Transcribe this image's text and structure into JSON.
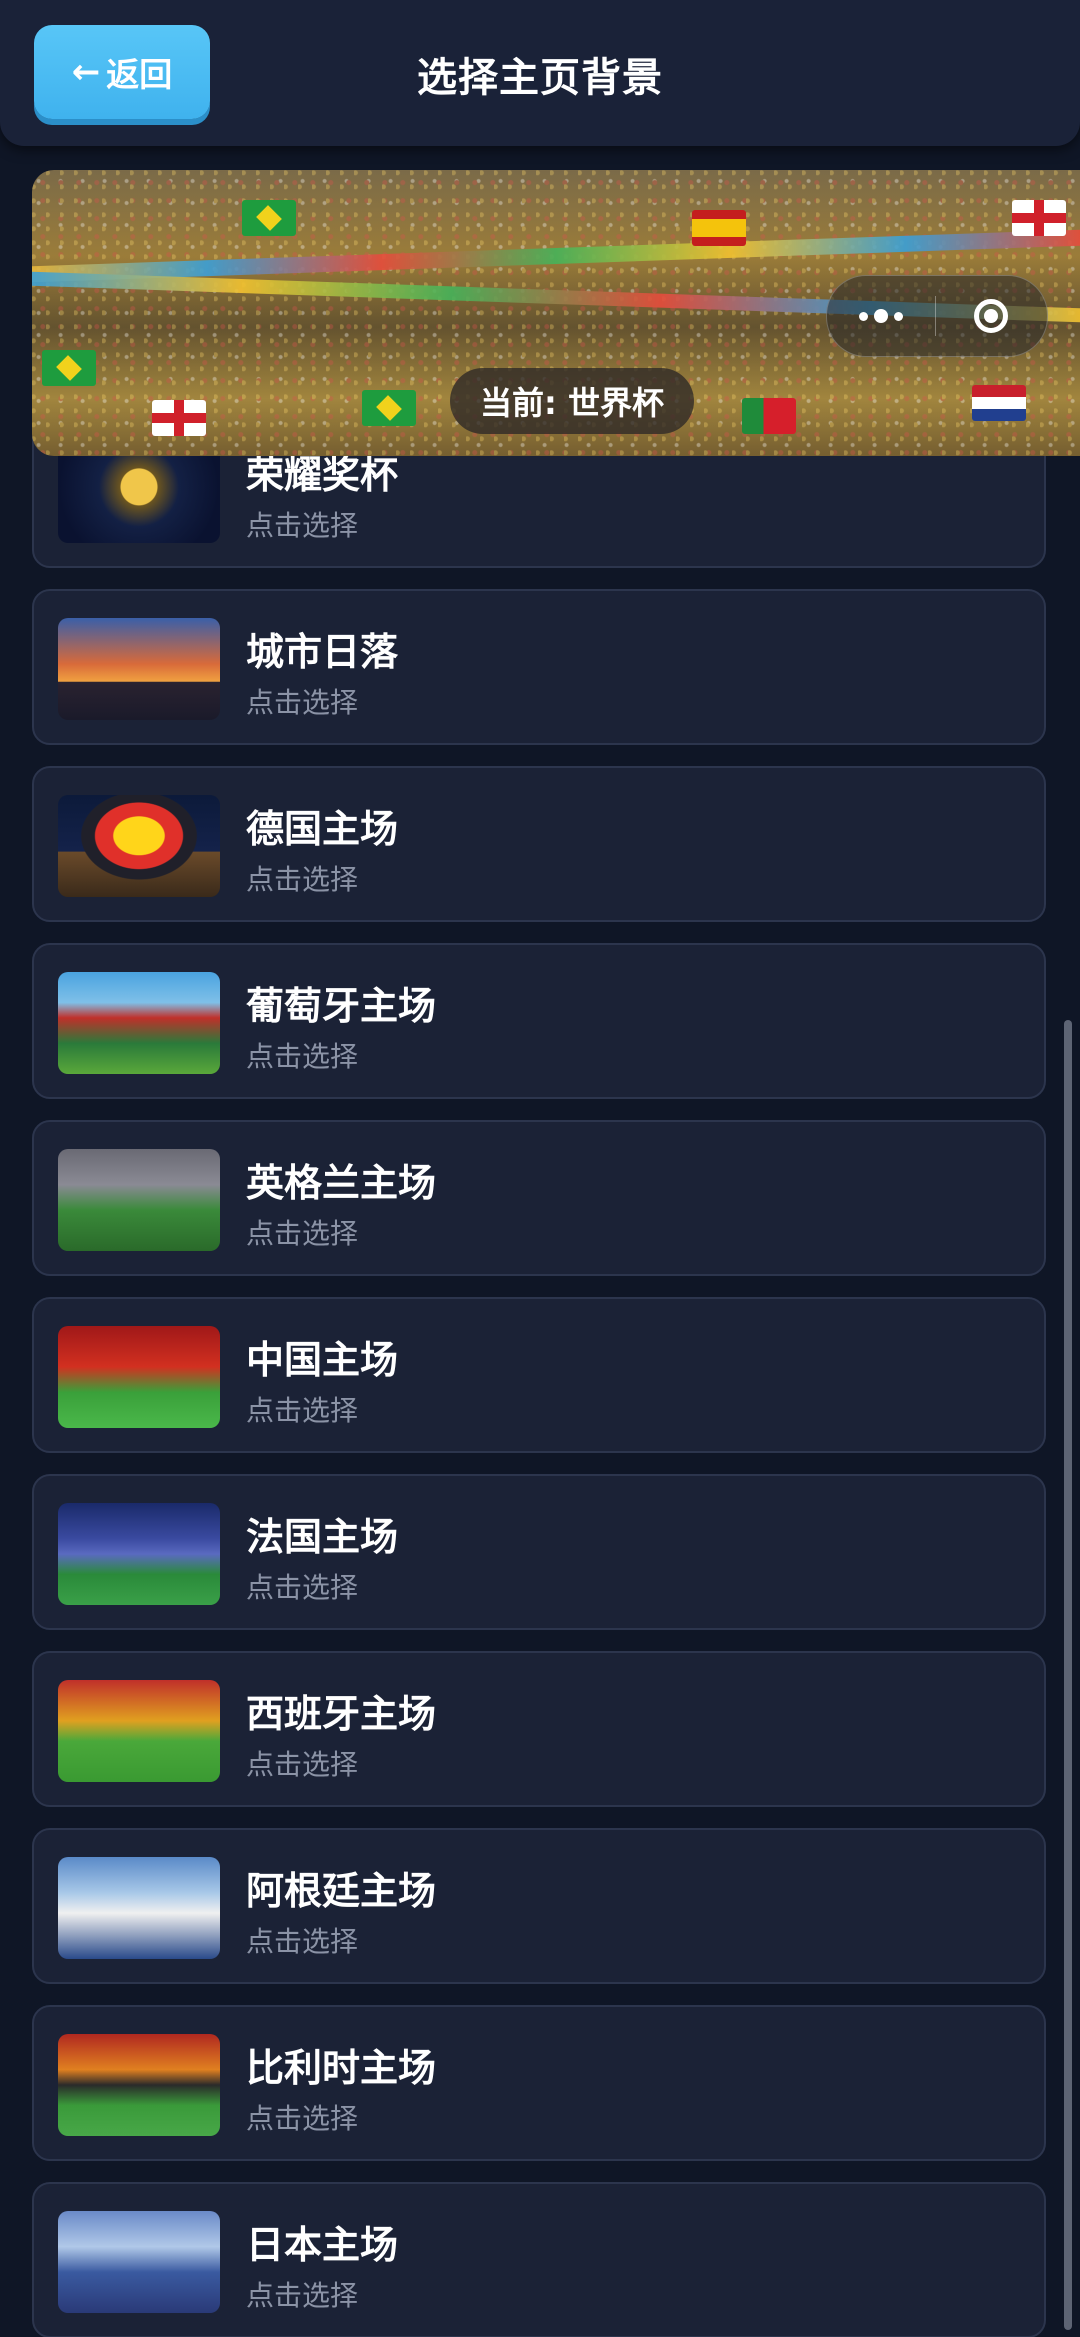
{
  "header": {
    "back_arrow": "←",
    "back_label": "返回",
    "title": "选择主页背景"
  },
  "banner": {
    "current_label": "当前: 世界杯"
  },
  "capsule": {
    "more_icon": "more-icon",
    "close_icon": "target-icon"
  },
  "list": {
    "items": [
      {
        "title": "荣耀奖杯",
        "subtitle": "点击选择",
        "thumb": "trophy"
      },
      {
        "title": "城市日落",
        "subtitle": "点击选择",
        "thumb": "sunset"
      },
      {
        "title": "德国主场",
        "subtitle": "点击选择",
        "thumb": "germany"
      },
      {
        "title": "葡萄牙主场",
        "subtitle": "点击选择",
        "thumb": "portugal"
      },
      {
        "title": "英格兰主场",
        "subtitle": "点击选择",
        "thumb": "england"
      },
      {
        "title": "中国主场",
        "subtitle": "点击选择",
        "thumb": "china"
      },
      {
        "title": "法国主场",
        "subtitle": "点击选择",
        "thumb": "france"
      },
      {
        "title": "西班牙主场",
        "subtitle": "点击选择",
        "thumb": "spain"
      },
      {
        "title": "阿根廷主场",
        "subtitle": "点击选择",
        "thumb": "argentina"
      },
      {
        "title": "比利时主场",
        "subtitle": "点击选择",
        "thumb": "belgium"
      },
      {
        "title": "日本主场",
        "subtitle": "点击选择",
        "thumb": "japan"
      }
    ]
  },
  "colors": {
    "background": "#0f1626",
    "card": "#1b2236",
    "card_border": "#2c354d",
    "accent": "#4fbdf3",
    "subtitle": "#8b93a6"
  }
}
